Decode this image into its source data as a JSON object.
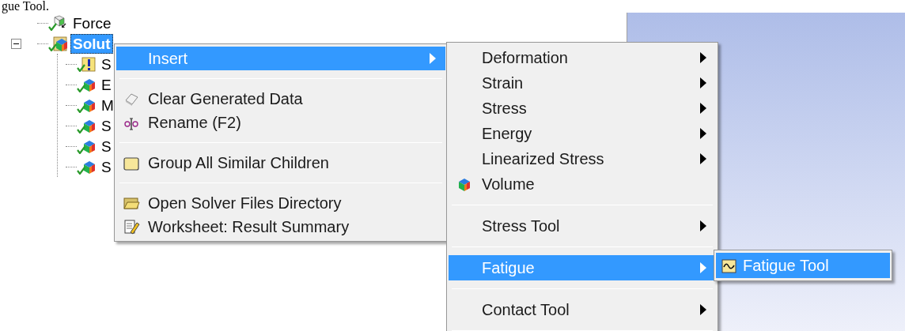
{
  "heading": "gue Tool.",
  "tree": {
    "items": [
      {
        "label": "Force",
        "kind": "force",
        "selected": false
      },
      {
        "label": "Solut",
        "kind": "solution",
        "selected": true,
        "expanded": true,
        "children": [
          {
            "label": "S",
            "kind": "warning",
            "selected": false
          },
          {
            "label": "E",
            "kind": "result",
            "selected": false
          },
          {
            "label": "M",
            "kind": "result",
            "selected": false
          },
          {
            "label": "S",
            "kind": "result",
            "selected": false
          },
          {
            "label": "S",
            "kind": "result",
            "selected": false
          },
          {
            "label": "S",
            "kind": "result",
            "selected": false
          }
        ]
      }
    ]
  },
  "context_menu": {
    "items": [
      {
        "kind": "plain",
        "label": "Insert",
        "selected": true,
        "submenu": true
      },
      {
        "kind": "separator"
      },
      {
        "kind": "eraser",
        "label": "Clear Generated Data",
        "selected": false,
        "submenu": false
      },
      {
        "kind": "rename",
        "label": "Rename (F2)",
        "selected": false,
        "submenu": false
      },
      {
        "kind": "separator"
      },
      {
        "kind": "folder",
        "label": "Group All Similar Children",
        "selected": false,
        "submenu": false
      },
      {
        "kind": "separator"
      },
      {
        "kind": "open-folder",
        "label": "Open Solver Files Directory",
        "selected": false,
        "submenu": false
      },
      {
        "kind": "worksheet",
        "label": "Worksheet: Result Summary",
        "selected": false,
        "submenu": false
      }
    ]
  },
  "insert_menu": {
    "items": [
      {
        "kind": "plain",
        "label": "Deformation",
        "selected": false,
        "submenu": true
      },
      {
        "kind": "plain",
        "label": "Strain",
        "selected": false,
        "submenu": true
      },
      {
        "kind": "plain",
        "label": "Stress",
        "selected": false,
        "submenu": true
      },
      {
        "kind": "plain",
        "label": "Energy",
        "selected": false,
        "submenu": true
      },
      {
        "kind": "plain",
        "label": "Linearized Stress",
        "selected": false,
        "submenu": true
      },
      {
        "kind": "cube",
        "label": "Volume",
        "selected": false,
        "submenu": false
      },
      {
        "kind": "separator"
      },
      {
        "kind": "plain",
        "label": "Stress Tool",
        "selected": false,
        "submenu": true
      },
      {
        "kind": "separator"
      },
      {
        "kind": "plain",
        "label": "Fatigue",
        "selected": true,
        "submenu": true
      },
      {
        "kind": "separator"
      },
      {
        "kind": "plain",
        "label": "Contact Tool",
        "selected": false,
        "submenu": true
      },
      {
        "kind": "separator"
      }
    ]
  },
  "fatigue_menu": {
    "items": [
      {
        "kind": "fatigue",
        "label": "Fatigue Tool",
        "selected": true
      }
    ]
  }
}
